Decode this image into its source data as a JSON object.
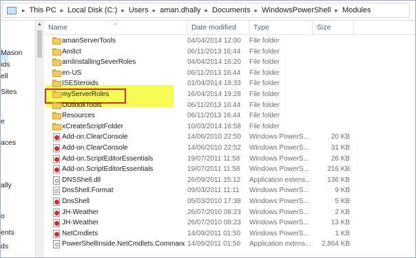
{
  "breadcrumb": {
    "items": [
      "This PC",
      "Local Disk (C:)",
      "Users",
      "aman.dhally",
      "Documents",
      "WindowsPowerShell",
      "Modules"
    ]
  },
  "nav": {
    "items": [
      "Mason",
      "ids",
      "ell",
      "Sites",
      "e",
      "aces",
      "ally",
      "o",
      "ents",
      "ds"
    ]
  },
  "columns": {
    "name": "Name",
    "date": "Date modified",
    "type": "Type",
    "size": "Size"
  },
  "files": [
    {
      "name": "amanServerTools",
      "date": "04/04/2014 12:00",
      "type": "File folder",
      "size": "",
      "icon": "folder-icon"
    },
    {
      "name": "AmlIct",
      "date": "06/11/2013 16:44",
      "type": "File folder",
      "size": "",
      "icon": "folder-icon"
    },
    {
      "name": "amlInstallingSeverRoles",
      "date": "04/04/2014 16:20",
      "type": "File folder",
      "size": "",
      "icon": "folder-icon"
    },
    {
      "name": "en-US",
      "date": "06/11/2013 16:44",
      "type": "File folder",
      "size": "",
      "icon": "folder-icon"
    },
    {
      "name": "ISESteroids",
      "date": "01/04/2014 18:33",
      "type": "File folder",
      "size": "",
      "icon": "folder-icon"
    },
    {
      "name": "myServerRoles",
      "date": "16/04/2014 19:28",
      "type": "File folder",
      "size": "",
      "icon": "folder-icon"
    },
    {
      "name": "OutlookTools",
      "date": "06/11/2013 16:44",
      "type": "File folder",
      "size": "",
      "icon": "folder-icon"
    },
    {
      "name": "Resources",
      "date": "06/11/2013 16:44",
      "type": "File folder",
      "size": "",
      "icon": "folder-icon"
    },
    {
      "name": "xCreateScriptFolder",
      "date": "10/03/2014 16:58",
      "type": "File folder",
      "size": "",
      "icon": "folder-icon"
    },
    {
      "name": "Add-on.ClearConsole",
      "date": "14/06/2010 22:50",
      "type": "Windows PowerS...",
      "size": "20 KB",
      "icon": "script-icon"
    },
    {
      "name": "Add-on.ClearConsole",
      "date": "14/06/2010 22:52",
      "type": "Windows PowerS...",
      "size": "31 KB",
      "icon": "script-icon"
    },
    {
      "name": "Add-on.ScriptEditorEssentials",
      "date": "19/07/2011 11:58",
      "type": "Windows PowerS...",
      "size": "26 KB",
      "icon": "script-icon"
    },
    {
      "name": "Add-on.ScriptEditorEssentials",
      "date": "19/07/2011 11:58",
      "type": "Windows PowerS...",
      "size": "216 KB",
      "icon": "script-icon"
    },
    {
      "name": "DNSShell.dll",
      "date": "26/09/2011 15:12",
      "type": "Application extens...",
      "size": "136 KB",
      "icon": "dll-icon"
    },
    {
      "name": "DnsShell.Format",
      "date": "09/03/2011 11:11",
      "type": "Windows PowerS...",
      "size": "9 KB",
      "icon": "format-icon"
    },
    {
      "name": "DnsShell",
      "date": "05/03/2010 17:38",
      "type": "Windows PowerS...",
      "size": "5 KB",
      "icon": "script-icon"
    },
    {
      "name": "JH-Weather",
      "date": "26/07/2010 08:23",
      "type": "Windows PowerS...",
      "size": "2 KB",
      "icon": "script-icon"
    },
    {
      "name": "JH-Weather",
      "date": "26/07/2010 08:23",
      "type": "Windows PowerS...",
      "size": "13 KB",
      "icon": "script-icon"
    },
    {
      "name": "NetCmdlets",
      "date": "14/09/2011 01:50",
      "type": "Windows PowerS...",
      "size": "1 KB",
      "icon": "script-icon"
    },
    {
      "name": "PowerShellInside.NetCmdlets.Command...",
      "date": "14/09/2011 01:50",
      "type": "Application extens...",
      "size": "2,864 KB",
      "icon": "dll-icon"
    }
  ],
  "colors": {
    "highlight": "#f4fb35",
    "annotation_box": "#d62b2b",
    "header_text": "#4c607a"
  }
}
